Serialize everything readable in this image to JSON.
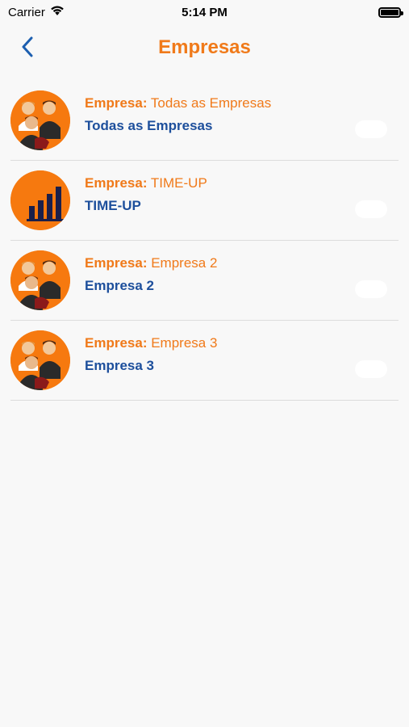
{
  "status_bar": {
    "carrier": "Carrier",
    "time": "5:14 PM"
  },
  "nav": {
    "title": "Empresas",
    "back_icon": "chevron-left-icon"
  },
  "colors": {
    "accent_orange": "#f07a1a",
    "accent_blue": "#1d4f9c",
    "avatar_bg": "#f6790f"
  },
  "items": [
    {
      "label": "Empresa:",
      "value": "Todas as Empresas",
      "title": "Todas as Empresas",
      "icon": "people-group-icon"
    },
    {
      "label": "Empresa:",
      "value": "TIME-UP",
      "title": "TIME-UP",
      "icon": "bar-chart-icon"
    },
    {
      "label": "Empresa:",
      "value": "Empresa 2",
      "title": "Empresa 2",
      "icon": "people-group-icon"
    },
    {
      "label": "Empresa:",
      "value": "Empresa 3",
      "title": "Empresa 3",
      "icon": "people-group-icon"
    }
  ]
}
